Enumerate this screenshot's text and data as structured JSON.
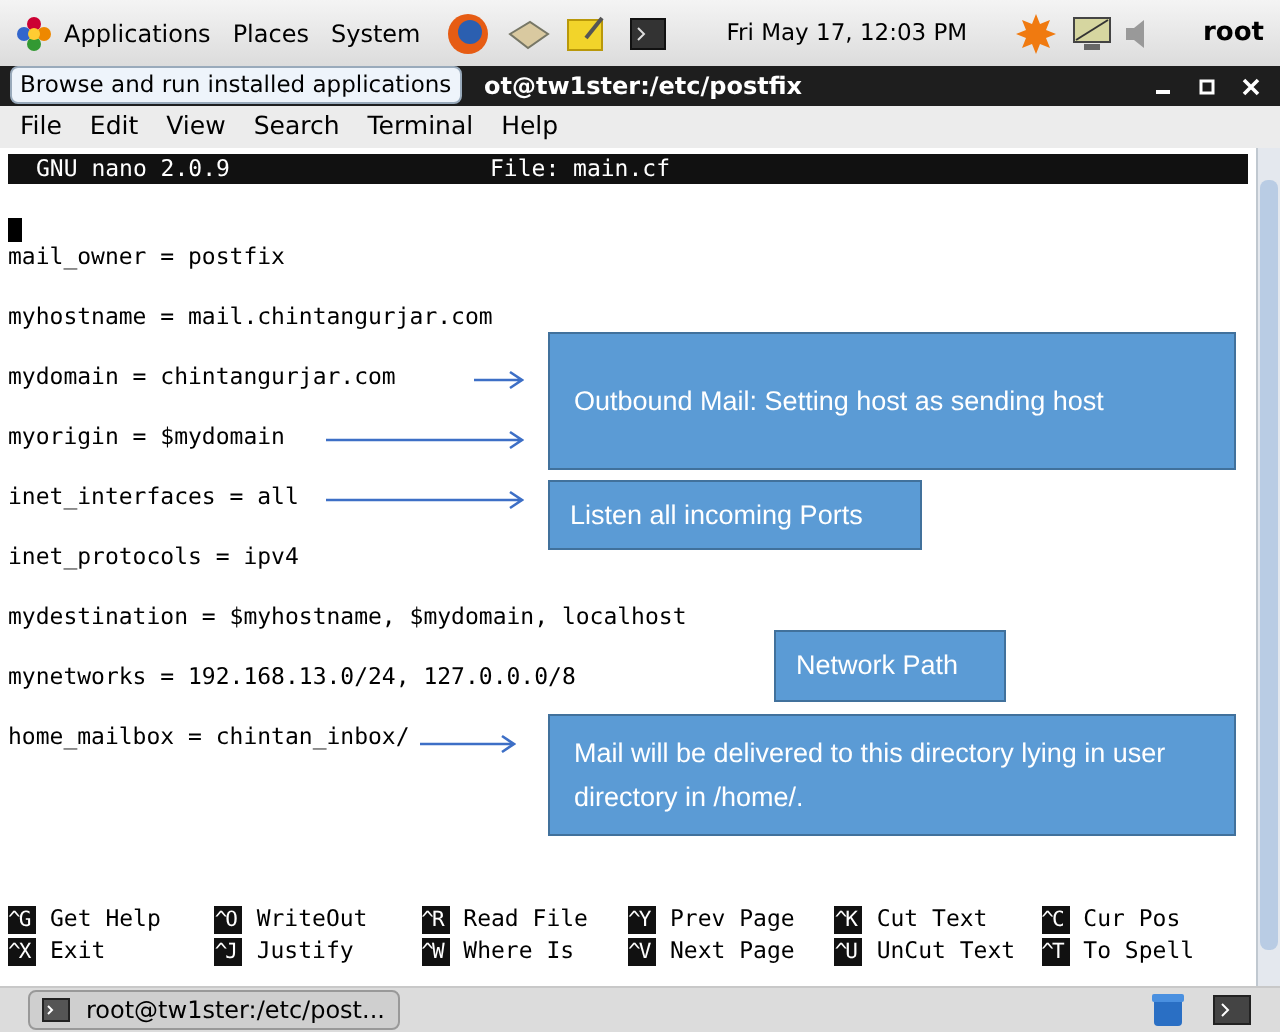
{
  "top_panel": {
    "menus": [
      "Applications",
      "Places",
      "System"
    ],
    "clock": "Fri May 17, 12:03 PM",
    "user": "root"
  },
  "tooltip": "Browse and run installed applications",
  "window": {
    "title": "ot@tw1ster:/etc/postfix",
    "menu": [
      "File",
      "Edit",
      "View",
      "Search",
      "Terminal",
      "Help"
    ]
  },
  "nano": {
    "version": "GNU nano 2.0.9",
    "file": "File: main.cf",
    "lines": [
      "mail_owner = postfix",
      "myhostname = mail.chintangurjar.com",
      "mydomain = chintangurjar.com",
      "myorigin = $mydomain",
      "inet_interfaces = all",
      "inet_protocols = ipv4",
      "mydestination = $myhostname, $mydomain, localhost",
      "mynetworks = 192.168.13.0/24, 127.0.0.0/8",
      "home_mailbox = chintan_inbox/"
    ],
    "shortcuts": [
      {
        "key": "^G",
        "label": "Get Help"
      },
      {
        "key": "^O",
        "label": "WriteOut"
      },
      {
        "key": "^R",
        "label": "Read File"
      },
      {
        "key": "^Y",
        "label": "Prev Page"
      },
      {
        "key": "^K",
        "label": "Cut Text"
      },
      {
        "key": "^C",
        "label": "Cur Pos"
      },
      {
        "key": "^X",
        "label": "Exit"
      },
      {
        "key": "^J",
        "label": "Justify"
      },
      {
        "key": "^W",
        "label": "Where Is"
      },
      {
        "key": "^V",
        "label": "Next Page"
      },
      {
        "key": "^U",
        "label": "UnCut Text"
      },
      {
        "key": "^T",
        "label": "To Spell"
      }
    ]
  },
  "annotations": [
    "Outbound Mail: Setting host as sending host",
    "Listen all incoming Ports",
    "Network Path",
    "Mail will be delivered to this directory lying in user directory in /home/."
  ],
  "taskbar": {
    "task": "root@tw1ster:/etc/post..."
  }
}
